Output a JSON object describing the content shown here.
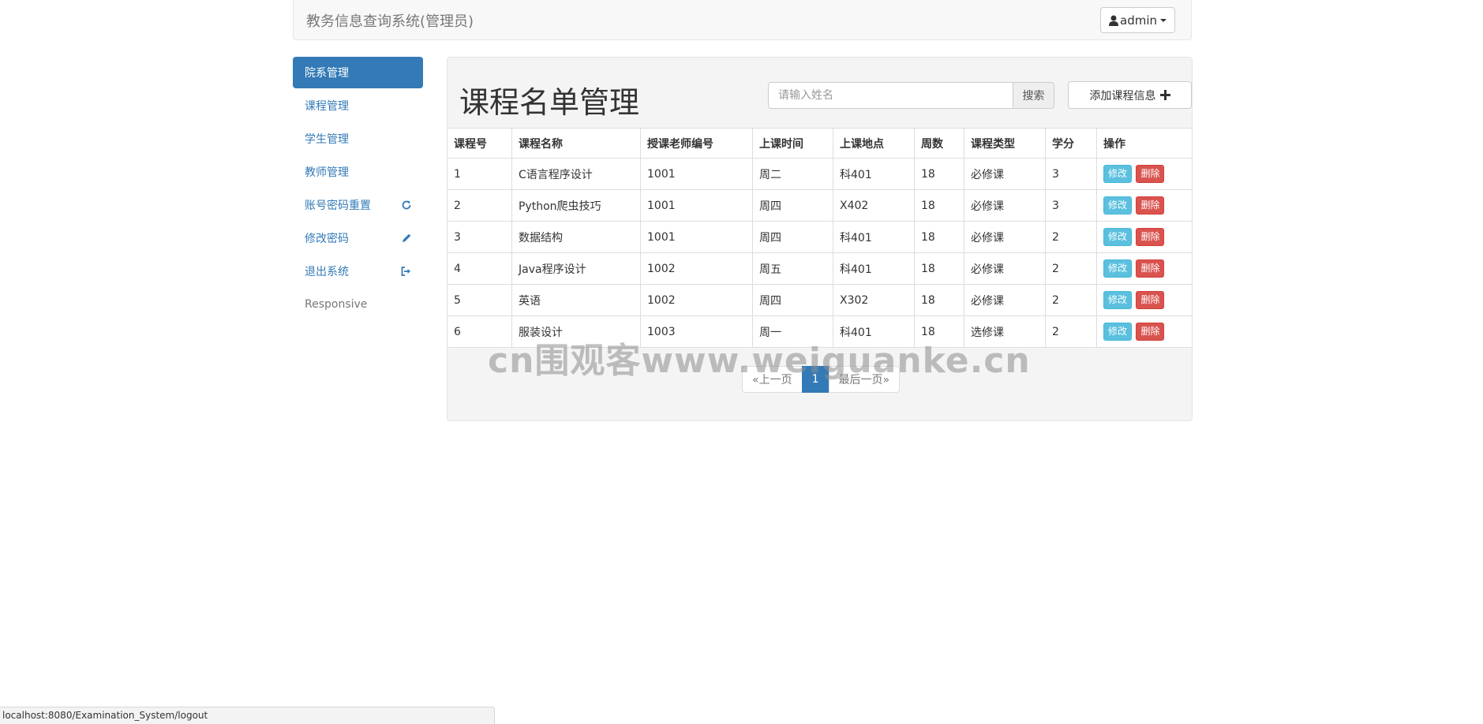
{
  "header": {
    "brand": "教务信息查询系统(管理员)",
    "user_label": "admin"
  },
  "sidebar": {
    "items": [
      {
        "label": "院系管理",
        "active": true
      },
      {
        "label": "课程管理"
      },
      {
        "label": "学生管理"
      },
      {
        "label": "教师管理"
      },
      {
        "label": "账号密码重置",
        "icon": "refresh-icon"
      },
      {
        "label": "修改密码",
        "icon": "pencil-icon"
      },
      {
        "label": "退出系统",
        "icon": "logout-icon"
      },
      {
        "label": "Responsive"
      }
    ]
  },
  "main": {
    "title": "课程名单管理",
    "search_placeholder": "请输入姓名",
    "search_button": "搜索",
    "add_button": "添加课程信息"
  },
  "table": {
    "columns": [
      "课程号",
      "课程名称",
      "授课老师编号",
      "上课时间",
      "上课地点",
      "周数",
      "课程类型",
      "学分",
      "操作"
    ],
    "rows": [
      [
        "1",
        "C语言程序设计",
        "1001",
        "周二",
        "科401",
        "18",
        "必修课",
        "3"
      ],
      [
        "2",
        "Python爬虫技巧",
        "1001",
        "周四",
        "X402",
        "18",
        "必修课",
        "3"
      ],
      [
        "3",
        "数据结构",
        "1001",
        "周四",
        "科401",
        "18",
        "必修课",
        "2"
      ],
      [
        "4",
        "Java程序设计",
        "1002",
        "周五",
        "科401",
        "18",
        "必修课",
        "2"
      ],
      [
        "5",
        "英语",
        "1002",
        "周四",
        "X302",
        "18",
        "必修课",
        "2"
      ],
      [
        "6",
        "服装设计",
        "1003",
        "周一",
        "科401",
        "18",
        "选修课",
        "2"
      ]
    ],
    "edit_label": "修改",
    "delete_label": "删除"
  },
  "pagination": {
    "prev": "«上一页",
    "current": "1",
    "last": "最后一页»"
  },
  "watermark": "cn围观客www.weiguanke.cn",
  "status_bar": "localhost:8080/Examination_System/logout",
  "colors": {
    "primary": "#337ab7",
    "info": "#5bc0de",
    "danger": "#d9534f"
  }
}
